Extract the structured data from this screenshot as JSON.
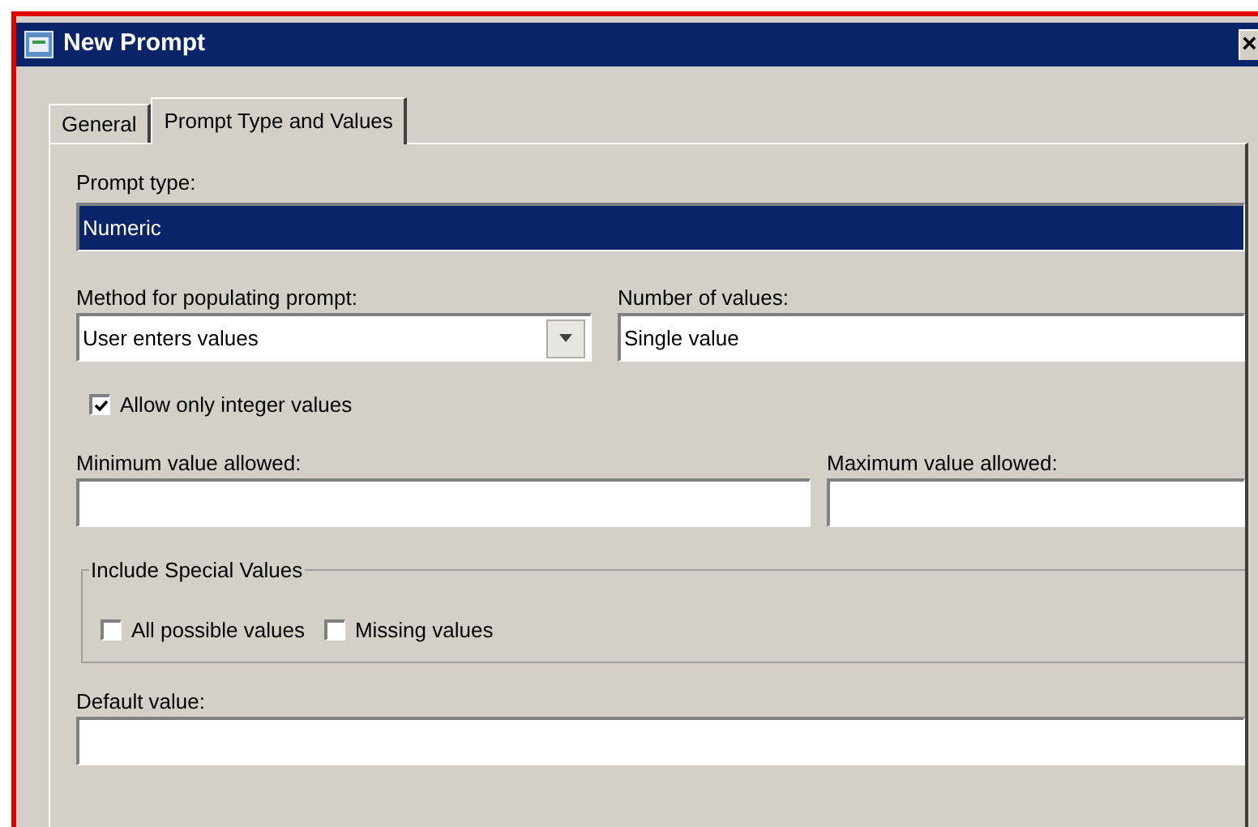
{
  "window": {
    "title": "New Prompt",
    "close": "×"
  },
  "tabs": [
    {
      "label": "General",
      "selected": false
    },
    {
      "label": "Prompt Type and Values",
      "selected": true
    }
  ],
  "prompt_type": {
    "label": "Prompt type:",
    "value": "Numeric",
    "selected": true
  },
  "method": {
    "label": "Method for populating prompt:",
    "value": "User enters values"
  },
  "number_of_values": {
    "label": "Number of values:",
    "value": "Single value"
  },
  "integer_only": {
    "label": "Allow only integer values",
    "checked": true
  },
  "minimum": {
    "label": "Minimum value allowed:"
  },
  "maximum": {
    "label": "Maximum value allowed:"
  },
  "special_values": {
    "title": "Include Special Values",
    "options": [
      {
        "label": "All possible values",
        "checked": false
      },
      {
        "label": "Missing values",
        "checked": false
      }
    ]
  },
  "default_value": {
    "label": "Default value:"
  }
}
